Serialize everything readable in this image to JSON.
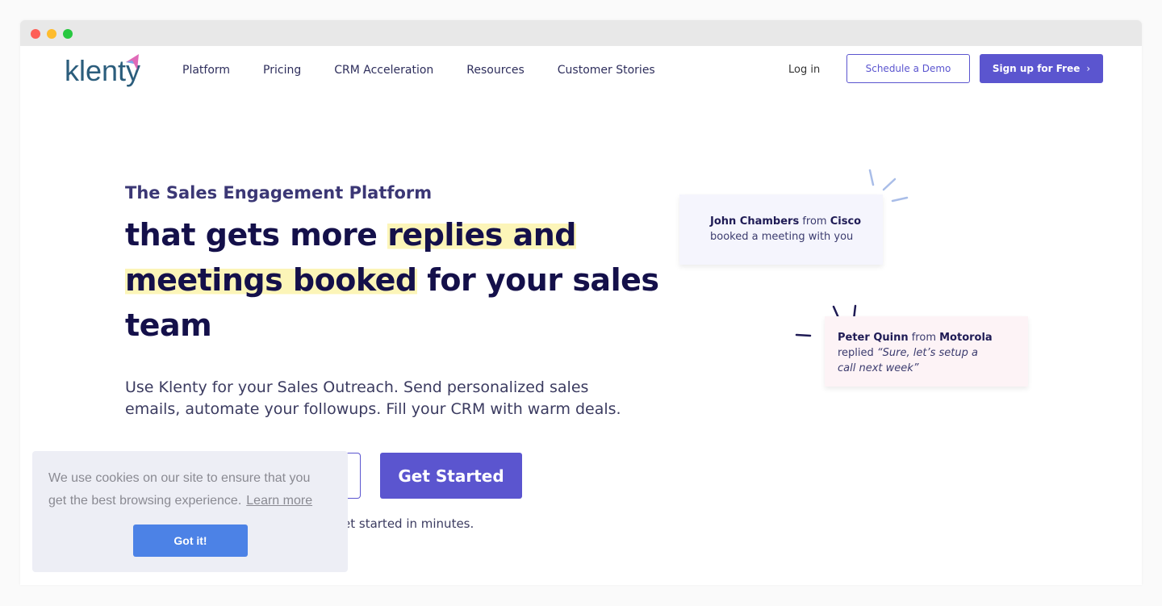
{
  "window": {
    "controls": [
      "close",
      "minimize",
      "maximize"
    ],
    "colors": {
      "close": "#fe5f57",
      "minimize": "#febc2e",
      "maximize": "#28c840"
    }
  },
  "nav": {
    "logo": "klenty",
    "links": [
      "Platform",
      "Pricing",
      "CRM Acceleration",
      "Resources",
      "Customer Stories"
    ],
    "login": "Log in",
    "demo": "Schedule a Demo",
    "signup": "Sign up for Free"
  },
  "hero": {
    "kicker": "The Sales Engagement Platform",
    "h1_a": "that gets more ",
    "h1_hl1": "replies and",
    "h1_hl2": "meetings booked",
    "h1_b": " for your sales team",
    "subtitle": "Use Klenty for your Sales Outreach. Send personalized sales emails, automate your followups. Fill your CRM with warm deals.",
    "cta": "Get Started",
    "note": "et started in minutes."
  },
  "cards": [
    {
      "name": "John Chambers",
      "from": " from ",
      "company": "Cisco",
      "text": "booked a meeting with you"
    },
    {
      "name": "Peter Quinn",
      "from": " from ",
      "company": "Motorola",
      "text": "replied ",
      "quote": "“Sure, let’s setup a call next week”"
    }
  ],
  "cookie": {
    "text": "We use cookies on our site to ensure that you get the best browsing experience.",
    "learn": "Learn more",
    "button": "Got it!"
  },
  "colors": {
    "accent": "#5b55cf",
    "heading": "#14104a",
    "highlight": "#fcf5b8",
    "cookie_button": "#4c82e6"
  }
}
